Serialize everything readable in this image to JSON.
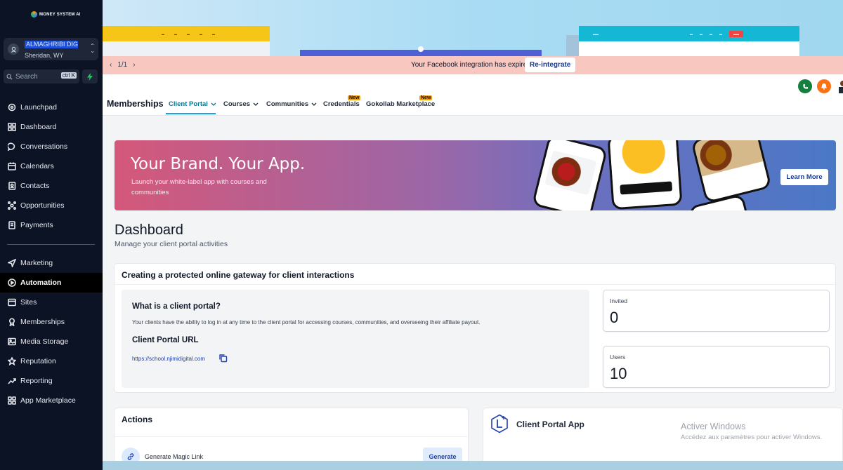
{
  "brand": {
    "logo_text": "MONEY SYSTEM AI"
  },
  "account": {
    "name": "ALMAGHRIBI DIGIT...",
    "location": "Sheridan, WY"
  },
  "search": {
    "placeholder": "Search",
    "shortcut": "ctrl K"
  },
  "sidebar": {
    "items": [
      {
        "label": "Launchpad",
        "icon": "rocket-icon"
      },
      {
        "label": "Dashboard",
        "icon": "grid-icon"
      },
      {
        "label": "Conversations",
        "icon": "chat-icon"
      },
      {
        "label": "Calendars",
        "icon": "calendar-icon"
      },
      {
        "label": "Contacts",
        "icon": "contacts-icon"
      },
      {
        "label": "Opportunities",
        "icon": "opportunities-icon"
      },
      {
        "label": "Payments",
        "icon": "payments-icon"
      }
    ],
    "items2": [
      {
        "label": "Marketing",
        "icon": "send-icon"
      },
      {
        "label": "Automation",
        "icon": "automation-icon",
        "active": true
      },
      {
        "label": "Sites",
        "icon": "sites-icon"
      },
      {
        "label": "Memberships",
        "icon": "memberships-icon"
      },
      {
        "label": "Media Storage",
        "icon": "image-icon"
      },
      {
        "label": "Reputation",
        "icon": "star-icon"
      },
      {
        "label": "Reporting",
        "icon": "chart-icon"
      },
      {
        "label": "App Marketplace",
        "icon": "apps-icon"
      }
    ]
  },
  "alert": {
    "pager": "1/1",
    "message": "Your Facebook integration has expired.",
    "action": "Re-integrate"
  },
  "header": {
    "title": "Memberships",
    "tabs": [
      {
        "label": "Client Portal",
        "active": true
      },
      {
        "label": "Courses"
      },
      {
        "label": "Communities"
      },
      {
        "label": "Credentials",
        "badge": "New"
      },
      {
        "label": "Gokollab Marketplace",
        "badge": "New"
      }
    ]
  },
  "banner": {
    "title": "Your Brand. Your App.",
    "subtitle": "Launch your white-label app with courses and communities",
    "cta": "Learn More"
  },
  "dashboard": {
    "title": "Dashboard",
    "subtitle": "Manage your client portal activities"
  },
  "gateway": {
    "title": "Creating a protected online gateway for client interactions",
    "what_title": "What is a client portal?",
    "what_text": "Your clients have the ability to log in at any time to the client portal for accessing courses, communities, and overseeing their affiliate payout.",
    "url_title": "Client Portal URL",
    "url": "https://school.njimidigital.com"
  },
  "stats": {
    "invited_label": "Invited",
    "invited_value": "0",
    "users_label": "Users",
    "users_value": "10"
  },
  "actions": {
    "title": "Actions",
    "magic_label": "Generate Magic Link",
    "generate": "Generate"
  },
  "app": {
    "title": "Client Portal App"
  },
  "watermark": {
    "line1": "Activer Windows",
    "line2": "Accédez aux paramètres pour activer Windows."
  },
  "colors": {
    "sidebar_bg": "#0b1325",
    "accent": "#0ea5e9",
    "alert_bg": "#f8c7c0",
    "banner_start": "#d4587a",
    "banner_end": "#4a78c6"
  }
}
